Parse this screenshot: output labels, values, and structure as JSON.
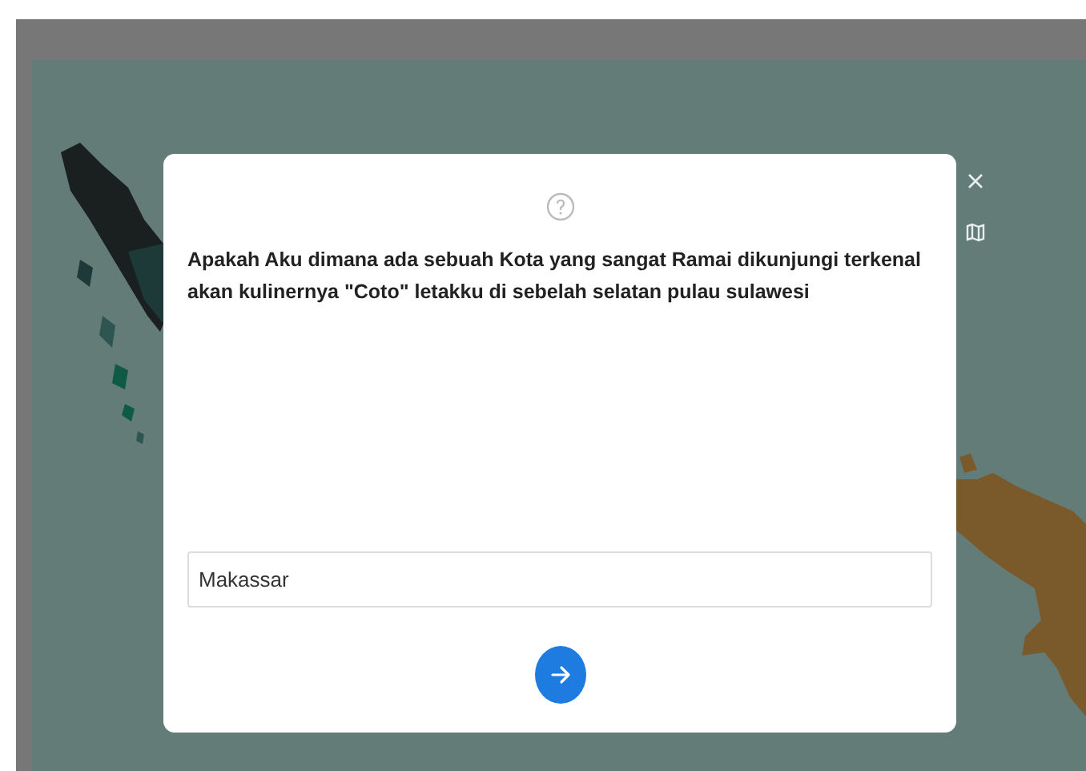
{
  "dialog": {
    "question": "Apakah Aku dimana ada sebuah Kota yang sangat Ramai dikunjungi terkenal akan kulinernya \"Coto\" letakku di sebelah selatan pulau sulawesi",
    "answer": "Makassar"
  }
}
